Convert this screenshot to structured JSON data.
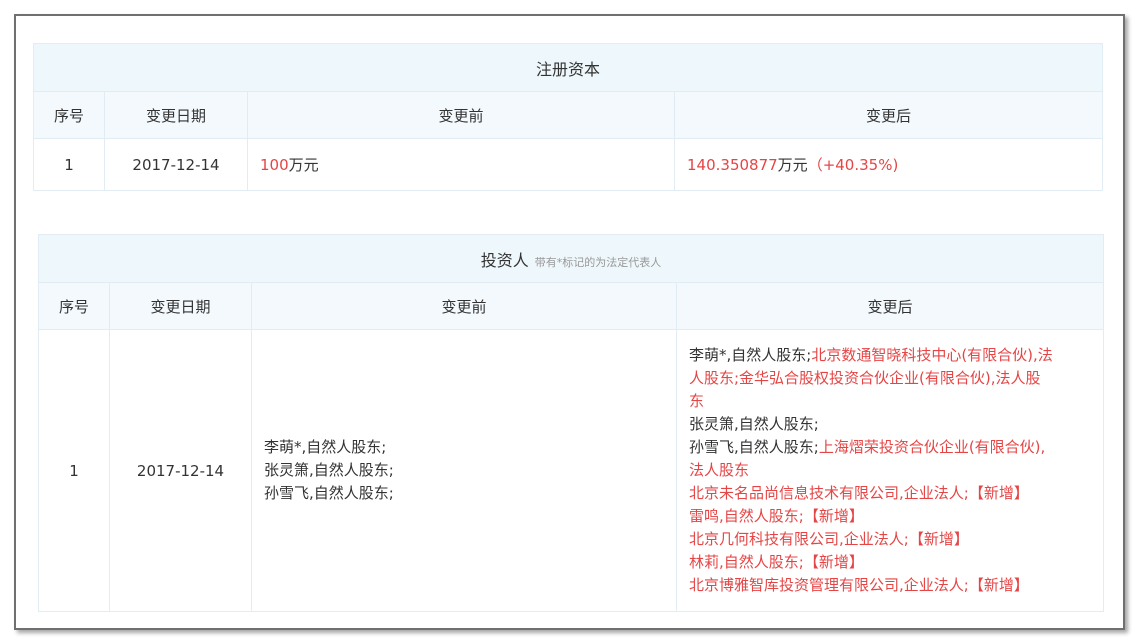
{
  "registered_capital": {
    "title": "注册资本",
    "headers": [
      "序号",
      "变更日期",
      "变更前",
      "变更后"
    ],
    "row": {
      "index": "1",
      "date": "2017-12-14",
      "before_amount": "100",
      "before_unit": "万元",
      "after_amount": "140.350877",
      "after_unit": "万元",
      "after_change": "（+40.35%)"
    }
  },
  "investors": {
    "title": "投资人",
    "note": "带有*标记的为法定代表人",
    "headers": [
      "序号",
      "变更日期",
      "变更前",
      "变更后"
    ],
    "row": {
      "index": "1",
      "date": "2017-12-14",
      "before": [
        "李萌*,自然人股东;",
        "张灵箫,自然人股东;",
        "孙雪飞,自然人股东;"
      ],
      "after": {
        "l1a": "李萌*,自然人股东;",
        "l1b": "北京数通智晓科技中心(有限合伙),法",
        "l2": "人股东;金华弘合股权投资合伙企业(有限合伙),法人股",
        "l3": "东",
        "l4": "张灵箫,自然人股东;",
        "l5a": "孙雪飞,自然人股东;",
        "l5b": "上海熠荣投资合伙企业(有限合伙),",
        "l6": "法人股东",
        "l7": "北京未名品尚信息技术有限公司,企业法人;【新增】",
        "l8": "雷鸣,自然人股东;【新增】",
        "l9": "北京几何科技有限公司,企业法人;【新增】",
        "l10": "林莉,自然人股东;【新增】",
        "l11": "北京博雅智库投资管理有限公司,企业法人;【新增】"
      }
    }
  },
  "colors": {
    "accent_red": "#e64545",
    "title_bg": "#eef7fb",
    "border": "#e2ecf3"
  }
}
